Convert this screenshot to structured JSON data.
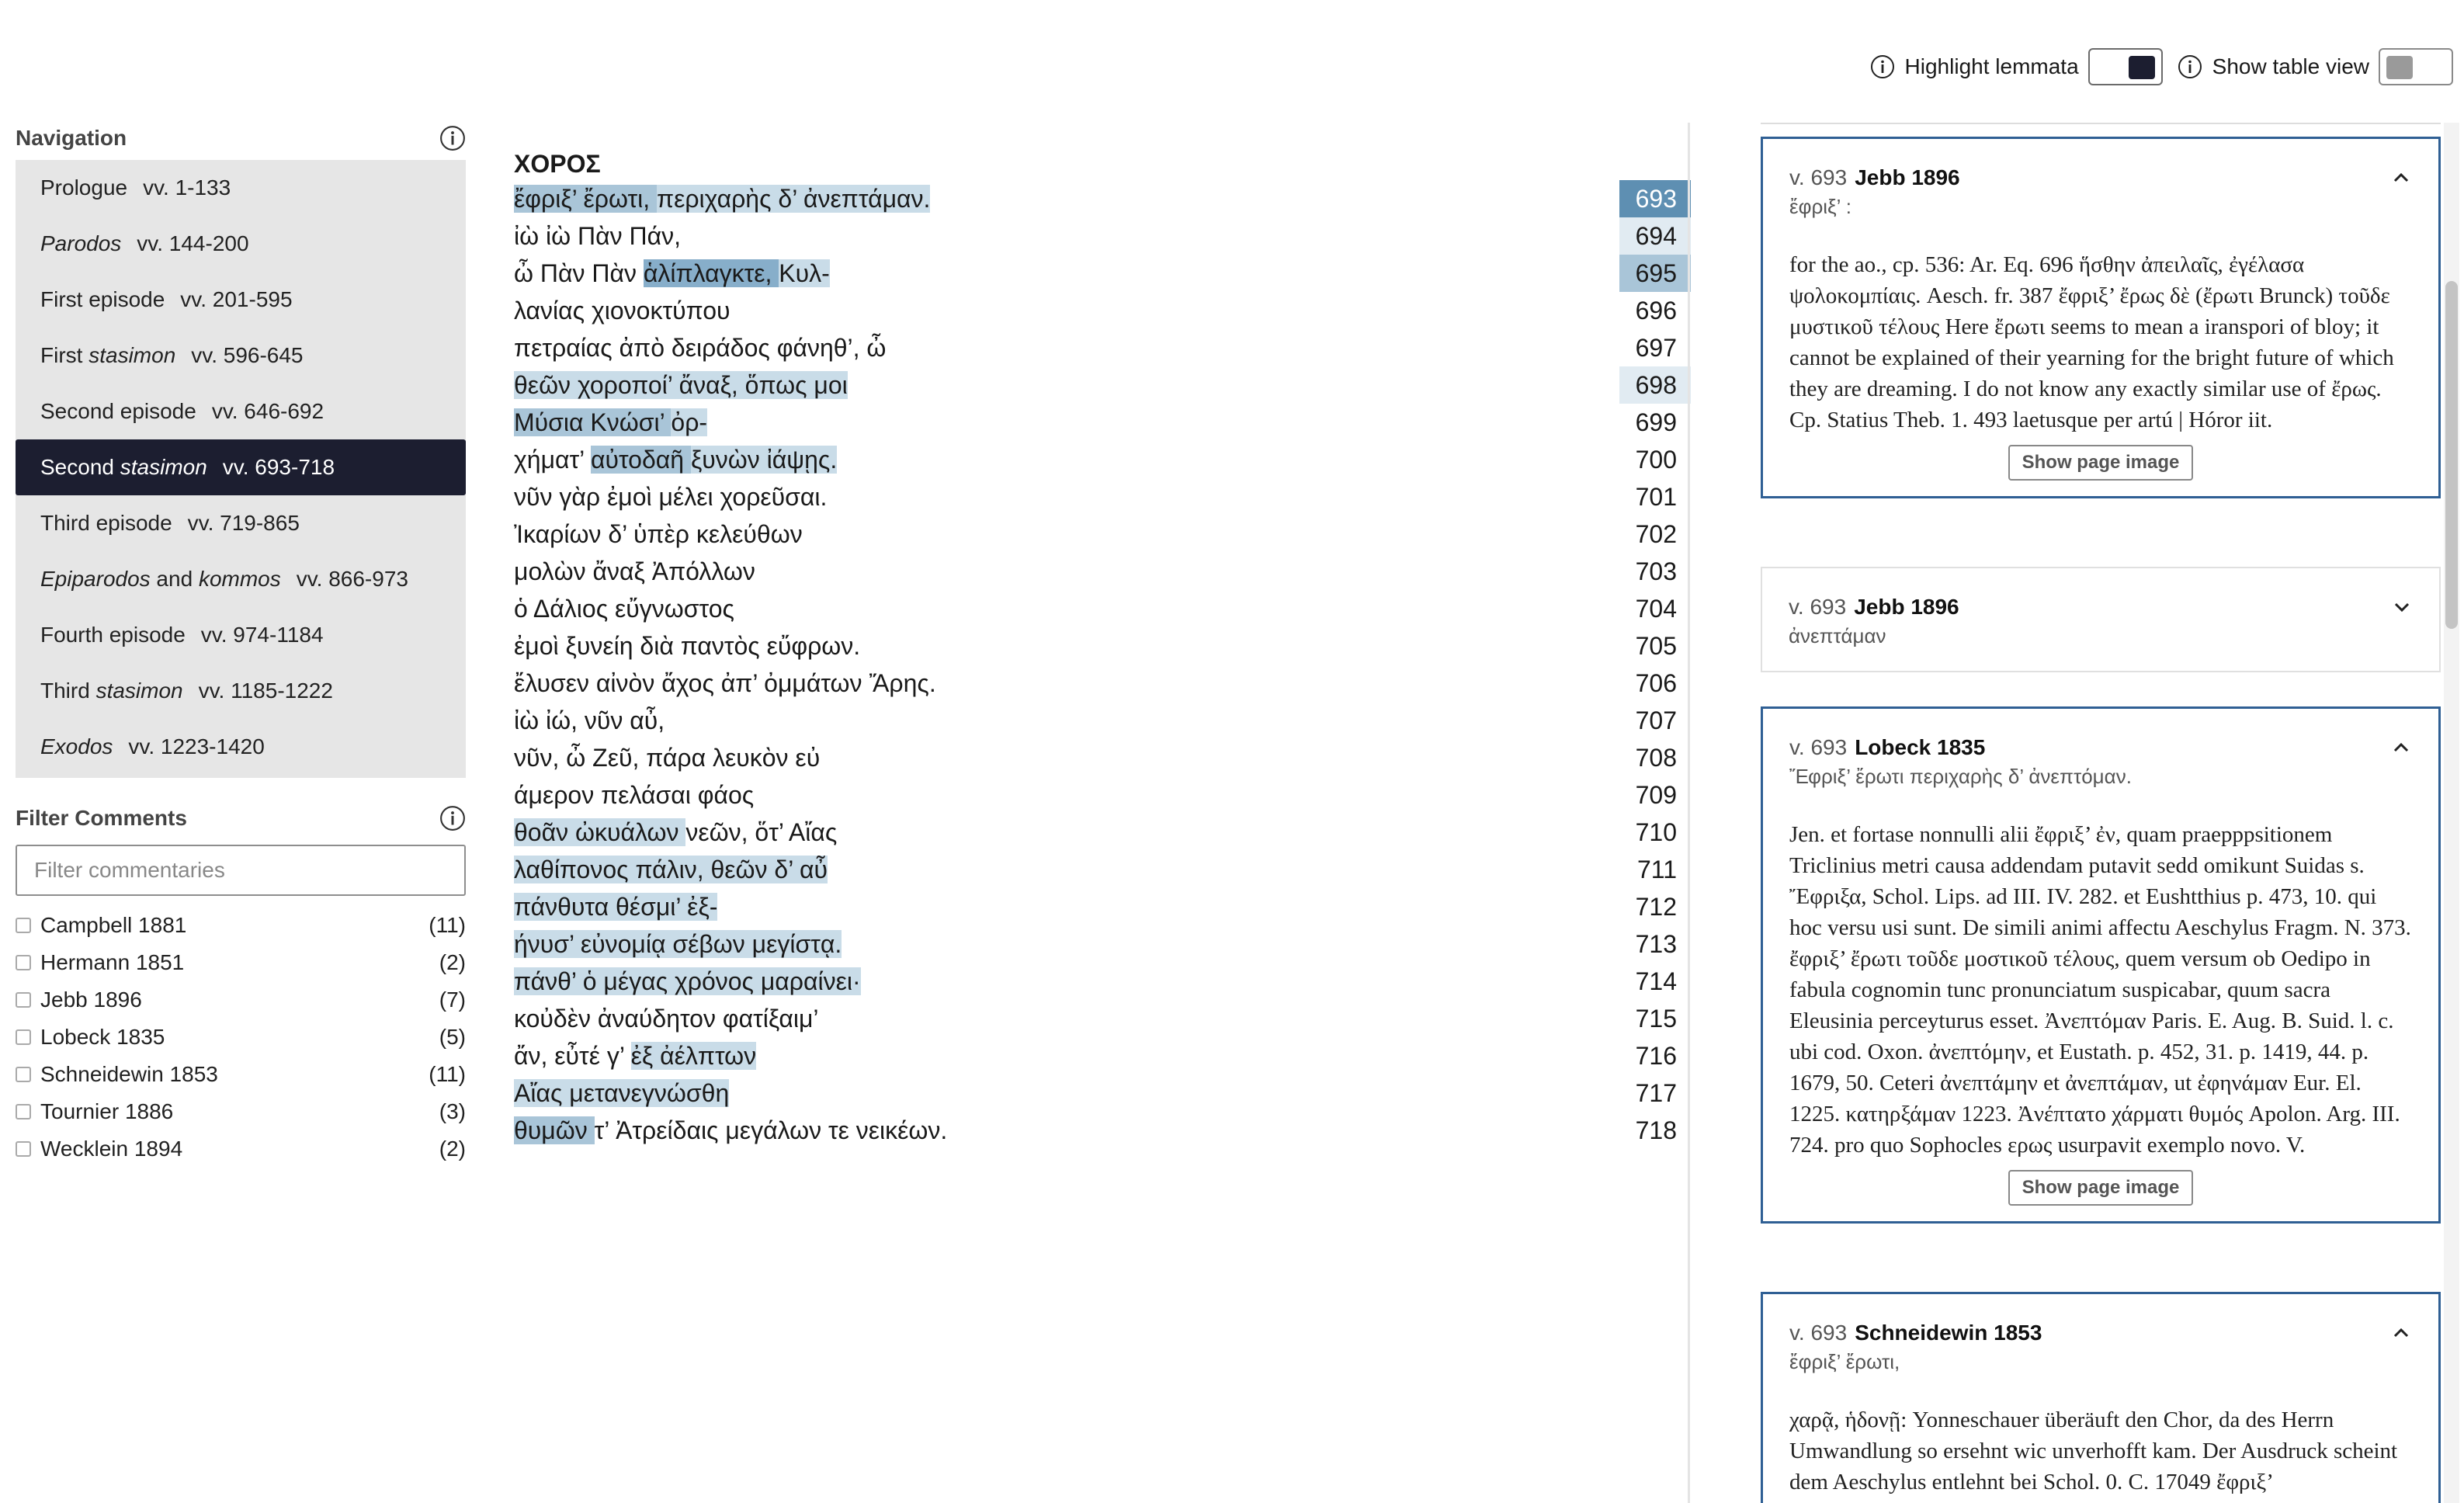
{
  "topbar": {
    "highlight_label": "Highlight lemmata",
    "table_label": "Show table view"
  },
  "navigation": {
    "title": "Navigation",
    "items": [
      {
        "pre": "Prologue",
        "it": "",
        "post": "",
        "verses": "vv. 1-133"
      },
      {
        "pre": "",
        "it": "Parodos",
        "post": "",
        "verses": "vv. 144-200"
      },
      {
        "pre": "First episode",
        "it": "",
        "post": "",
        "verses": "vv. 201-595"
      },
      {
        "pre": "First ",
        "it": "stasimon",
        "post": "",
        "verses": "vv. 596-645"
      },
      {
        "pre": "Second episode",
        "it": "",
        "post": "",
        "verses": "vv. 646-692"
      },
      {
        "pre": "Second ",
        "it": "stasimon",
        "post": "",
        "verses": "vv. 693-718"
      },
      {
        "pre": "Third episode",
        "it": "",
        "post": "",
        "verses": "vv. 719-865"
      },
      {
        "pre": "",
        "it": "Epiparodos",
        "post": " and ",
        "it2": "kommos",
        "verses": "vv. 866-973"
      },
      {
        "pre": "Fourth episode",
        "it": "",
        "post": "",
        "verses": "vv. 974-1184"
      },
      {
        "pre": "Third ",
        "it": "stasimon",
        "post": "",
        "verses": "vv. 1185-1222"
      },
      {
        "pre": "",
        "it": "Exodos",
        "post": "",
        "verses": "vv. 1223-1420"
      }
    ]
  },
  "filter": {
    "title": "Filter Comments",
    "placeholder": "Filter commentaries",
    "items": [
      {
        "label": "Campbell 1881",
        "count": "(11)"
      },
      {
        "label": "Hermann 1851",
        "count": "(2)"
      },
      {
        "label": "Jebb 1896",
        "count": "(7)"
      },
      {
        "label": "Lobeck 1835",
        "count": "(5)"
      },
      {
        "label": "Schneidewin 1853",
        "count": "(11)"
      },
      {
        "label": "Tournier 1886",
        "count": "(3)"
      },
      {
        "label": "Wecklein 1894",
        "count": "(2)"
      }
    ]
  },
  "text": {
    "speaker": "ΧΟΡΟΣ",
    "lines": [
      {
        "n": "693",
        "segs": [
          [
            "ἔφριξ’ ἔρωτι, ",
            "b"
          ],
          [
            "περιχαρὴς δ’ ἀνεπτάμαν.",
            "a"
          ]
        ]
      },
      {
        "n": "694",
        "segs": [
          [
            "ἰὼ ἰὼ Πὰν Πάν,",
            ""
          ]
        ]
      },
      {
        "n": "695",
        "segs": [
          [
            "ὦ Πὰν Πὰν ",
            ""
          ],
          [
            "ἁλίπλαγκτε, ",
            "c"
          ],
          [
            "Κυλ-",
            "a"
          ]
        ]
      },
      {
        "n": "696",
        "segs": [
          [
            "λανίας χιονοκτύπου",
            ""
          ]
        ]
      },
      {
        "n": "697",
        "segs": [
          [
            "πετραίας ἀπὸ δειράδος φάνηθ’, ὦ",
            ""
          ]
        ]
      },
      {
        "n": "698",
        "segs": [
          [
            "θεῶν χοροποί’ ἄναξ, ὅπως μοι",
            "a"
          ]
        ]
      },
      {
        "n": "699",
        "segs": [
          [
            "Μύσια Κνώσι’ ",
            "b"
          ],
          [
            "ὀρ-",
            "a"
          ]
        ]
      },
      {
        "n": "700",
        "segs": [
          [
            "χήματ’ ",
            ""
          ],
          [
            "αὐτοδαῆ ",
            "b"
          ],
          [
            "ξυνὼν ἰάψῃς.",
            "a"
          ]
        ]
      },
      {
        "n": "701",
        "segs": [
          [
            "νῦν γὰρ ἐμοὶ μέλει χορεῦσαι.",
            ""
          ]
        ]
      },
      {
        "n": "702",
        "segs": [
          [
            "Ἰκαρίων δ’ ὑπὲρ κελεύθων",
            ""
          ]
        ]
      },
      {
        "n": "703",
        "segs": [
          [
            "μολὼν ἄναξ Ἀπόλλων",
            ""
          ]
        ]
      },
      {
        "n": "704",
        "segs": [
          [
            "ὁ Δάλιος εὔγνωστος",
            ""
          ]
        ]
      },
      {
        "n": "705",
        "segs": [
          [
            "ἐμοὶ ξυνείη διὰ παντὸς εὔφρων.",
            ""
          ]
        ]
      },
      {
        "n": "706",
        "segs": [
          [
            "ἔλυσεν αἰνὸν ἄχος ἀπ’ ὀμμάτων Ἄρης.",
            ""
          ]
        ]
      },
      {
        "n": "707",
        "segs": [
          [
            "ἰὼ ἰώ, νῦν αὖ,",
            ""
          ]
        ]
      },
      {
        "n": "708",
        "segs": [
          [
            "νῦν, ὦ Ζεῦ, πάρα λευκὸν εὐ",
            ""
          ]
        ]
      },
      {
        "n": "709",
        "segs": [
          [
            "άμερον πελάσαι φάος",
            ""
          ]
        ]
      },
      {
        "n": "710",
        "segs": [
          [
            "θοᾶν ὠκυάλων ",
            "a"
          ],
          [
            "νεῶν, ὅτ’ Αἴας",
            ""
          ]
        ]
      },
      {
        "n": "711",
        "segs": [
          [
            "λαθίπονος πάλιν, θεῶν δ’ αὖ",
            "a"
          ]
        ]
      },
      {
        "n": "712",
        "segs": [
          [
            "πάνθυτα θέσμι’ ἐξ-",
            "a"
          ]
        ]
      },
      {
        "n": "713",
        "segs": [
          [
            "ήνυσ’ εὐνομίᾳ σέβων μεγίστᾳ.",
            "a"
          ]
        ]
      },
      {
        "n": "714",
        "segs": [
          [
            "πάνθ’ ὁ μέγας χρόνος μαραίνει·",
            "a"
          ]
        ]
      },
      {
        "n": "715",
        "segs": [
          [
            "κοὐδὲν ἀναύδητον φατίξαιμ’",
            ""
          ]
        ]
      },
      {
        "n": "716",
        "segs": [
          [
            "ἄν, εὖτέ γ’ ",
            ""
          ],
          [
            "ἐξ ἀέλπτων",
            "a"
          ]
        ]
      },
      {
        "n": "717",
        "segs": [
          [
            "Αἴας μετανεγνώσθη",
            "a"
          ]
        ]
      },
      {
        "n": "718",
        "segs": [
          [
            "θυμῶν ",
            "b"
          ],
          [
            "τ’ Ἀτρείδαις μεγάλων τε νεικέων.",
            ""
          ]
        ]
      }
    ]
  },
  "comments": [
    {
      "verse": "v. 693",
      "author": "Jebb 1896",
      "lemma": "ἔφριξ’ :",
      "expanded": true,
      "body": "for the ao., cp. 536: Ar. Eq. 696 ἥσθην ἀπειλαῖς, ἐγέλασα ψολοκομπίαις. Aesch. fr. 387 ἔφριξ’ ἔρως δὲ (ἔρωτι Brunck) τοῦδε μυστικοῦ τέλους Here ἔρωτι seems to mean a iranspori of bloy; it cannot be explained of their yearning for the bright future of which they are dreaming. I do not know any exactly similar use of ἔρως. Cp. Statius Theb. 1. 493 laetusque per artú | Hóror iit.",
      "button": "Show page image"
    },
    {
      "verse": "v. 693",
      "author": "Jebb 1896",
      "lemma": "ἀνεπτάμαν",
      "expanded": false
    },
    {
      "verse": "v. 693",
      "author": "Lobeck 1835",
      "lemma": "Ἔφριξ’ ἔρωτι περιχαρὴς δ’ ἀνεπτόμαν.",
      "expanded": true,
      "body": "Jen. et fortase nonnulli alii ἔφριξ’ ἐν, quam praepppsitionem Triclinius metri causa addendam putavit sedd omikunt Suidas s. Ἔφριξα, Schol. Lips. ad III. IV. 282. et Eushtthius p. 473, 10. qui hoc versu usi sunt. De simili animi affectu Aeschylus Fragm. N. 373. ἔφριξ’ ἔρωτι τοῦδε μοστικοῦ τέλους, quem versum ob Oedipo in fabula cognomin tunc pronunciatum suspicabar, quum sacra Eleusinia perceyturus esset. Ἀνεπτόμαν Paris. E. Aug. B. Suid. l. c. ubi cod. Oxon. ἀνεπτόμην, et Eustath. p. 452, 31. p. 1419, 44. p. 1679, 50. Ceteri ἀνεπτάμην et ἀνεπτάμαν, ut ἐφηνάμαν Eur. El. 1225. κατηρξάμαν 1223. Ἀνέπτατο χάρματι θυμός Apolon. Arg. III. 724. pro quo Sophocles ερως usurpavit exemplo novo. V.",
      "button": "Show page image"
    },
    {
      "verse": "v. 693",
      "author": "Schneidewin 1853",
      "lemma": "ἔφριξ’ ἔρωτι,",
      "expanded": true,
      "body": "χαρᾷ, ἡδονῇ: Yonneschauer überäuft den Chor, da des Herrn Umwandlung so ersehnt wic unverhofft kam. Der Ausdruck scheint dem Aeschylus entlehnt bei Schol. 0. C. 17049 ἔφριξ’"
    }
  ]
}
